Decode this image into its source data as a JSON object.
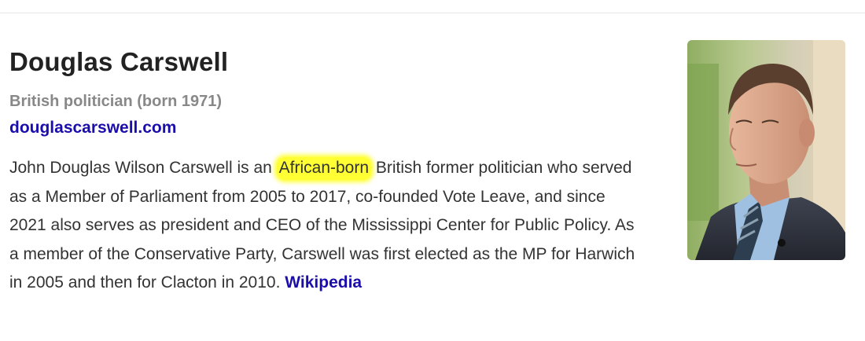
{
  "entity": {
    "name": "Douglas Carswell",
    "subtitle": "British politician (born 1971)",
    "website": "douglascarswell.com"
  },
  "description": {
    "before": "John Douglas Wilson Carswell is an ",
    "highlight": "African-born",
    "after": " British former politician who served as a Member of Parliament from 2005 to 2017, co-founded Vote Leave, and since 2021 also serves as president and CEO of the Mississippi Center for Public Policy. As a member of the Conservative Party, Carswell was first elected as the MP for Harwich in 2005 and then for Clacton in 2010. ",
    "source_link": "Wikipedia"
  },
  "colors": {
    "link": "#1a0dab",
    "highlight": "#ffff33"
  }
}
